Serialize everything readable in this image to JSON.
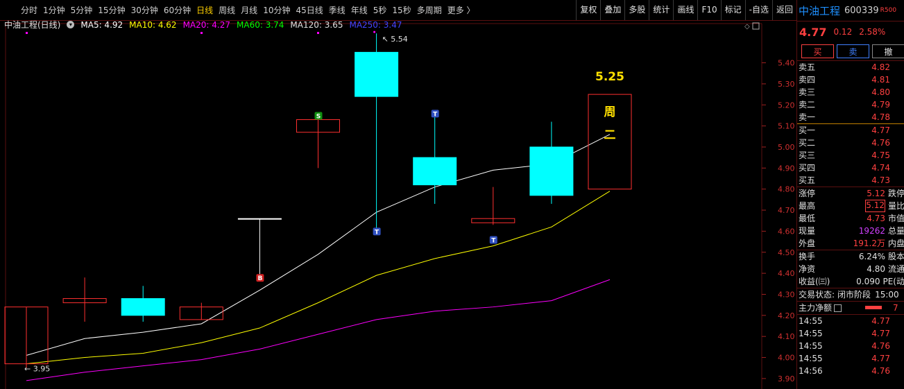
{
  "toolbar": {
    "timeframes": [
      "分时",
      "1分钟",
      "5分钟",
      "15分钟",
      "30分钟",
      "60分钟",
      "日线",
      "周线",
      "月线",
      "10分钟",
      "45日线",
      "季线",
      "年线",
      "5秒",
      "15秒",
      "多周期",
      "更多 〉"
    ],
    "active_timeframe": "日线",
    "tools": [
      "复权",
      "叠加",
      "多股",
      "统计",
      "画线",
      "F10",
      "标记",
      "-自选",
      "返回"
    ]
  },
  "legend": {
    "title": "中油工程(日线)",
    "items": [
      {
        "text": "MA5: 4.92",
        "color": "#ffffff"
      },
      {
        "text": "MA10: 4.62",
        "color": "#ffff00"
      },
      {
        "text": "MA20: 4.27",
        "color": "#ff00ff"
      },
      {
        "text": "MA60: 3.74",
        "color": "#00ff00"
      },
      {
        "text": "MA120: 3.65",
        "color": "#e0e0e0"
      },
      {
        "text": "MA250: 3.47",
        "color": "#4444ff"
      }
    ]
  },
  "chart_data": {
    "type": "candlestick",
    "y_ticks": [
      5.4,
      5.3,
      5.2,
      5.1,
      5.0,
      4.9,
      4.8,
      4.7,
      4.6,
      4.5,
      4.4,
      4.3,
      4.2,
      4.1,
      4.0,
      3.9
    ],
    "ylim": [
      3.87,
      5.56
    ],
    "candles": [
      {
        "o": 3.97,
        "h": 4.24,
        "l": 3.95,
        "c": 4.24,
        "style": "red"
      },
      {
        "o": 4.26,
        "h": 4.38,
        "l": 4.17,
        "c": 4.28,
        "style": "red"
      },
      {
        "o": 4.2,
        "h": 4.34,
        "l": 4.17,
        "c": 4.28,
        "style": "cyan"
      },
      {
        "o": 4.24,
        "h": 4.26,
        "l": 4.18,
        "c": 4.18,
        "style": "red"
      },
      {
        "o": 4.66,
        "h": 4.66,
        "l": 4.39,
        "c": 4.66,
        "style": "white"
      },
      {
        "o": 5.07,
        "h": 5.13,
        "l": 4.9,
        "c": 5.13,
        "style": "red"
      },
      {
        "o": 5.45,
        "h": 5.54,
        "l": 4.6,
        "c": 5.24,
        "style": "cyan"
      },
      {
        "o": 4.95,
        "h": 5.16,
        "l": 4.73,
        "c": 4.82,
        "style": "cyan"
      },
      {
        "o": 4.66,
        "h": 4.81,
        "l": 4.63,
        "c": 4.64,
        "style": "red"
      },
      {
        "o": 5.0,
        "h": 5.12,
        "l": 4.73,
        "c": 4.77,
        "style": "cyan"
      },
      {
        "o": 4.8,
        "h": 5.25,
        "l": 4.8,
        "c": 5.25,
        "style": "forecast"
      }
    ],
    "ma5": [
      4.01,
      4.09,
      4.12,
      4.16,
      4.32,
      4.49,
      4.69,
      4.81,
      4.89,
      4.92,
      5.06
    ],
    "ma10": [
      3.97,
      4.0,
      4.02,
      4.07,
      4.14,
      4.26,
      4.39,
      4.47,
      4.53,
      4.62,
      4.79
    ],
    "ma20": [
      3.89,
      3.93,
      3.96,
      3.99,
      4.04,
      4.11,
      4.18,
      4.22,
      4.24,
      4.27,
      4.37
    ],
    "markers": [
      {
        "i": 4,
        "text": "B",
        "price": 4.38,
        "kind": "buy"
      },
      {
        "i": 5,
        "text": "S",
        "price": 5.15,
        "kind": "sell"
      },
      {
        "i": 6,
        "text": "T",
        "price": 4.6,
        "kind": "t"
      },
      {
        "i": 7,
        "text": "T",
        "price": 5.16,
        "kind": "t"
      },
      {
        "i": 8,
        "text": "T",
        "price": 4.56,
        "kind": "t"
      }
    ],
    "high_label": "5.54",
    "low_label": "3.95",
    "forecast_price": "5.25",
    "forecast_text": "周二"
  },
  "panel": {
    "name": "中油工程",
    "code": "600339",
    "tag": "R500",
    "price": "4.77",
    "change": "0.12",
    "pct": "2.58%",
    "buttons": [
      "买",
      "卖",
      "撤"
    ],
    "sell": [
      {
        "label": "卖五",
        "price": "4.82"
      },
      {
        "label": "卖四",
        "price": "4.81"
      },
      {
        "label": "卖三",
        "price": "4.80"
      },
      {
        "label": "卖二",
        "price": "4.79"
      },
      {
        "label": "卖一",
        "price": "4.78"
      }
    ],
    "buy": [
      {
        "label": "买一",
        "price": "4.77"
      },
      {
        "label": "买二",
        "price": "4.76"
      },
      {
        "label": "买三",
        "price": "4.75"
      },
      {
        "label": "买四",
        "price": "4.74"
      },
      {
        "label": "买五",
        "price": "4.73"
      }
    ],
    "stats": [
      {
        "label": "涨停",
        "value": "5.12",
        "color": "red",
        "label2": "跌停"
      },
      {
        "label": "最高",
        "value": "5.12",
        "color": "red",
        "label2": "量比",
        "boxed": true
      },
      {
        "label": "最低",
        "value": "4.73",
        "color": "red",
        "label2": "市值"
      },
      {
        "label": "现量",
        "value": "19262",
        "color": "purple",
        "label2": "总量"
      },
      {
        "label": "外盘",
        "value": "191.2万",
        "color": "red",
        "label2": "内盘"
      }
    ],
    "stats2": [
      {
        "label": "换手",
        "value": "6.24%",
        "label2": "股本"
      },
      {
        "label": "净资",
        "value": "4.80",
        "label2": "流通"
      },
      {
        "label": "收益(㈢)",
        "value": "0.090",
        "label2": "PE(动"
      }
    ],
    "status_label": "交易状态:",
    "status_value": "闭市阶段",
    "status_time": "15:00",
    "flow_label": "主力净额",
    "flow_value": "7",
    "ticks": [
      {
        "time": "14:55",
        "price": "4.77"
      },
      {
        "time": "14:55",
        "price": "4.77"
      },
      {
        "time": "14:55",
        "price": "4.76"
      },
      {
        "time": "14:55",
        "price": "4.77"
      },
      {
        "time": "14:56",
        "price": "4.76"
      }
    ]
  }
}
